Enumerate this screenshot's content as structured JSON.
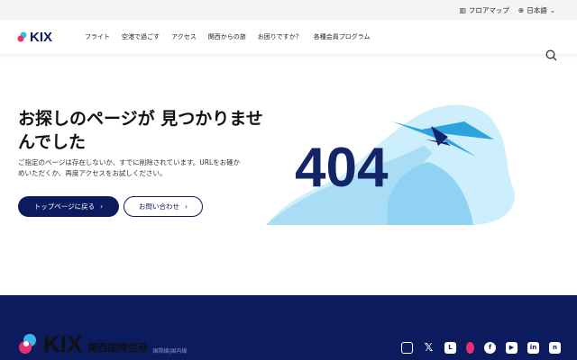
{
  "topbar": {
    "floor_map": "フロアマップ",
    "language": "日本語"
  },
  "header": {
    "logo": "KIX",
    "nav": [
      "フライト",
      "空港で過ごす",
      "アクセス",
      "関西からの旅",
      "お困りですか？",
      "各種会員プログラム"
    ]
  },
  "main": {
    "title": "お探しのページが 見つかりませんでした",
    "description": "ご指定のページは存在しないか、すでに削除されています。URLをお確かめいただくか、再度アクセスをお試しください。",
    "home_button": "トップページに戻る",
    "contact_button": "お問い合わせ",
    "error_code": "404"
  },
  "footer": {
    "logo": "KIX",
    "airport_name": "関西国際空港",
    "sub": "国際線|国内線",
    "social": [
      "instagram",
      "x",
      "line",
      "kix-character",
      "facebook",
      "youtube",
      "linkedin",
      "note"
    ]
  }
}
